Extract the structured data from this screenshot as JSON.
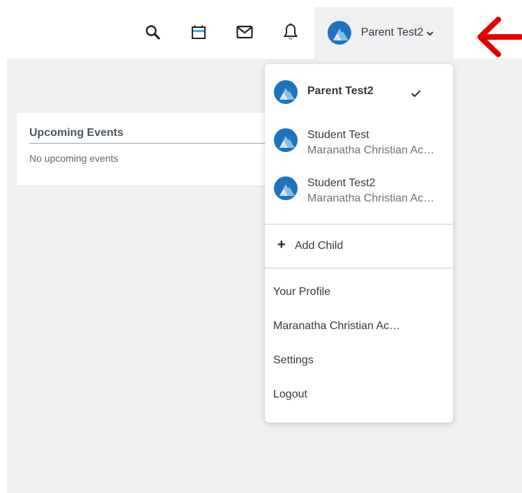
{
  "header": {
    "icons": [
      "search-icon",
      "calendar-icon",
      "mail-icon",
      "bell-icon"
    ],
    "user_name": "Parent Test2"
  },
  "events_card": {
    "title": "Upcoming Events",
    "empty_text": "No upcoming events"
  },
  "dropdown": {
    "accounts": [
      {
        "name": "Parent Test2",
        "subtitle": "",
        "selected": true
      },
      {
        "name": "Student Test",
        "subtitle": "Maranatha Christian Ac…",
        "selected": false
      },
      {
        "name": "Student Test2",
        "subtitle": "Maranatha Christian Ac…",
        "selected": false
      }
    ],
    "add_child_label": "Add Child",
    "menu_items": [
      "Your Profile",
      "Maranatha Christian Ac…",
      "Settings",
      "Logout"
    ]
  },
  "colors": {
    "accent": "#1e73be",
    "annotation_arrow": "#e00000",
    "background": "#eef0f2"
  }
}
